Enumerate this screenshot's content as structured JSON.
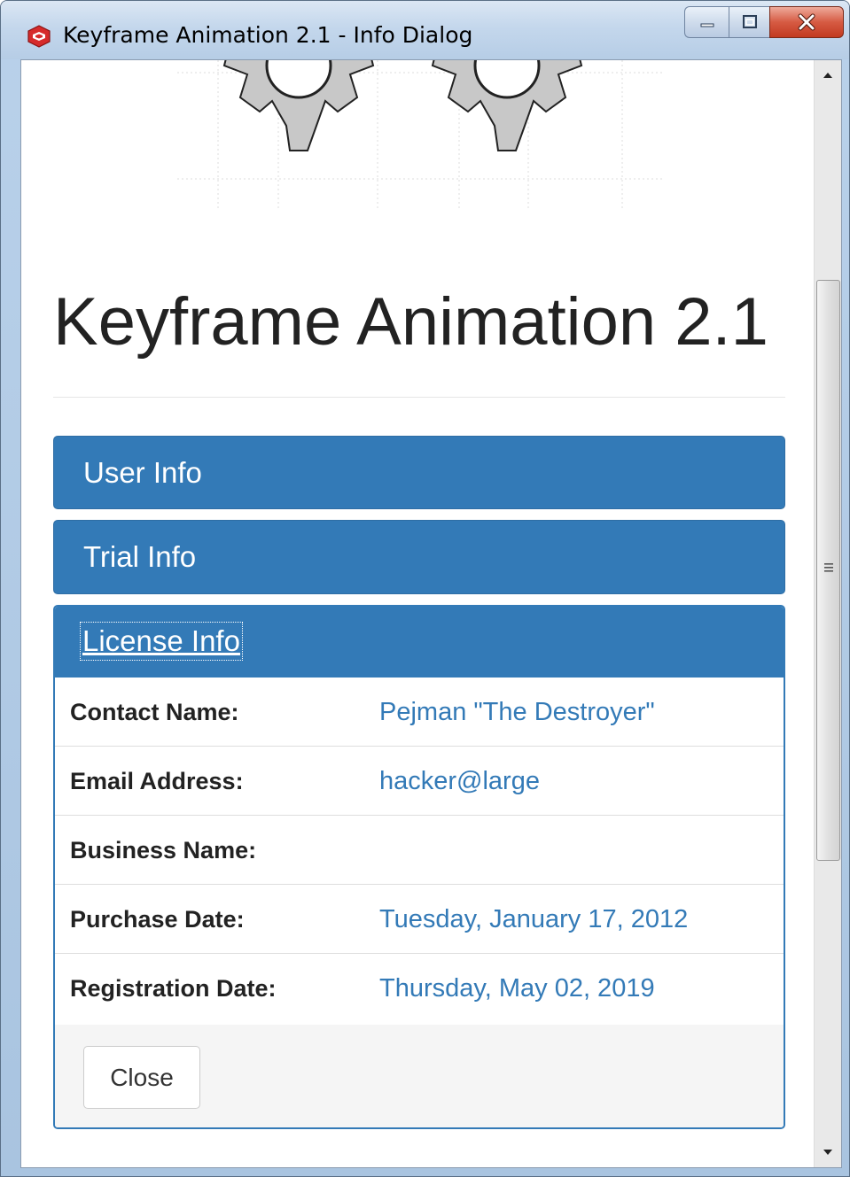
{
  "window": {
    "title": "Keyframe Animation 2.1 - Info Dialog",
    "icon": "sketchup-icon",
    "controls": [
      "minimize-icon",
      "maximize-icon",
      "close-icon"
    ]
  },
  "page": {
    "title": "Keyframe Animation 2.1"
  },
  "sections": {
    "user_info": "User Info",
    "trial_info": "Trial Info",
    "license_info": "License Info"
  },
  "license": {
    "rows": [
      {
        "label": "Contact Name:",
        "value": "Pejman \"The Destroyer\""
      },
      {
        "label": "Email Address:",
        "value": "hacker@large"
      },
      {
        "label": "Business Name:",
        "value": ""
      },
      {
        "label": "Purchase Date:",
        "value": "Tuesday, January 17, 2012"
      },
      {
        "label": "Registration Date:",
        "value": "Thursday, May 02, 2019"
      }
    ],
    "close_label": "Close"
  },
  "colors": {
    "panel_primary": "#337ab7",
    "link_value": "#337ab7",
    "heading_text": "#222222"
  }
}
